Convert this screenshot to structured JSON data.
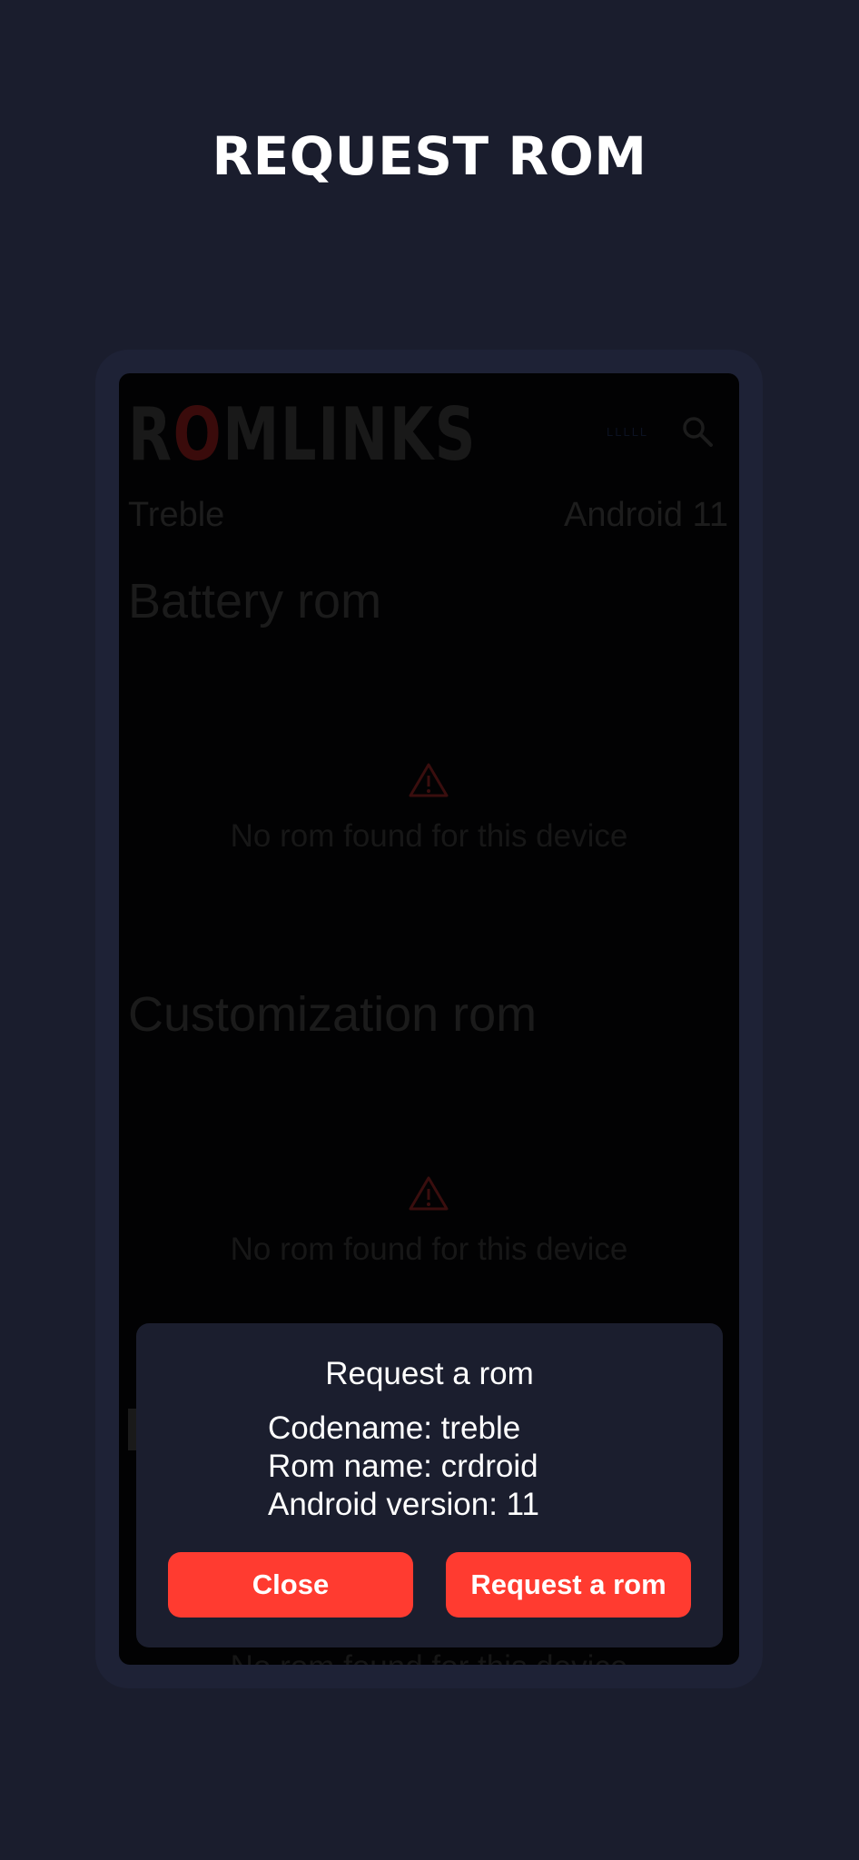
{
  "headline": "REQUEST ROM",
  "app": {
    "logo_text": "ROMLINKS",
    "logo_letters": [
      "R",
      "O",
      "MLINKS"
    ],
    "lang_tag": "LLLLL",
    "device": "Treble",
    "android": "Android 11",
    "sections": [
      {
        "title": "Battery rom",
        "empty": "No rom found for this device"
      },
      {
        "title": "Customization rom",
        "empty": "No rom found for this device"
      }
    ],
    "peek_empty": "No rom found for this device"
  },
  "dialog": {
    "title": "Request a rom",
    "codename": "Codename: treble",
    "rom_name": "Rom name: crdroid",
    "android_version": "Android version: 11",
    "close_label": "Close",
    "request_label": "Request a rom"
  },
  "colors": {
    "background": "#1a1d2d",
    "accent": "#ff3b30",
    "dialog_bg": "#1b1e2e",
    "frame": "#1e2236"
  },
  "icons": {
    "search": "search-icon",
    "warning": "warning-icon"
  }
}
